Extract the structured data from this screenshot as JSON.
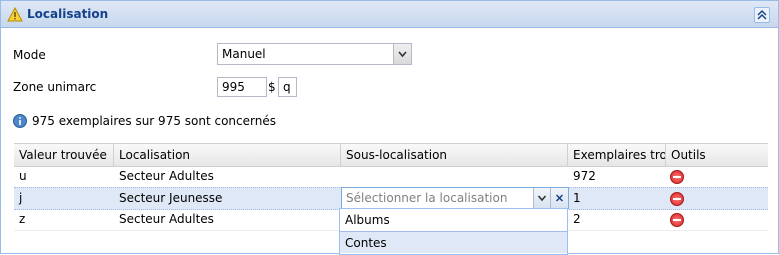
{
  "panel": {
    "title": "Localisation"
  },
  "form": {
    "mode_label": "Mode",
    "mode_value": "Manuel",
    "zone_label": "Zone unimarc",
    "zone_value": "995",
    "subfield_sep": "$",
    "subfield_value": "q"
  },
  "info": {
    "text": "975 exemplaires sur 975 sont concernés"
  },
  "grid": {
    "columns": [
      "Valeur trouvée",
      "Localisation",
      "Sous-localisation",
      "Exemplaires tro...",
      "Outils"
    ],
    "rows": [
      {
        "valeur": "u",
        "localisation": "Secteur Adultes",
        "sous_localisation": "",
        "exemplaires": "972"
      },
      {
        "valeur": "j",
        "localisation": "Secteur Jeunesse",
        "sous_localisation": "",
        "exemplaires": "1"
      },
      {
        "valeur": "z",
        "localisation": "Secteur Adultes",
        "sous_localisation": "",
        "exemplaires": "2"
      }
    ]
  },
  "editor": {
    "placeholder": "Sélectionner la localisation",
    "options": [
      "Albums",
      "Contes"
    ]
  },
  "colors": {
    "accent": "#15428b",
    "border": "#99bbe8",
    "selected_row": "#dfe8f6"
  }
}
